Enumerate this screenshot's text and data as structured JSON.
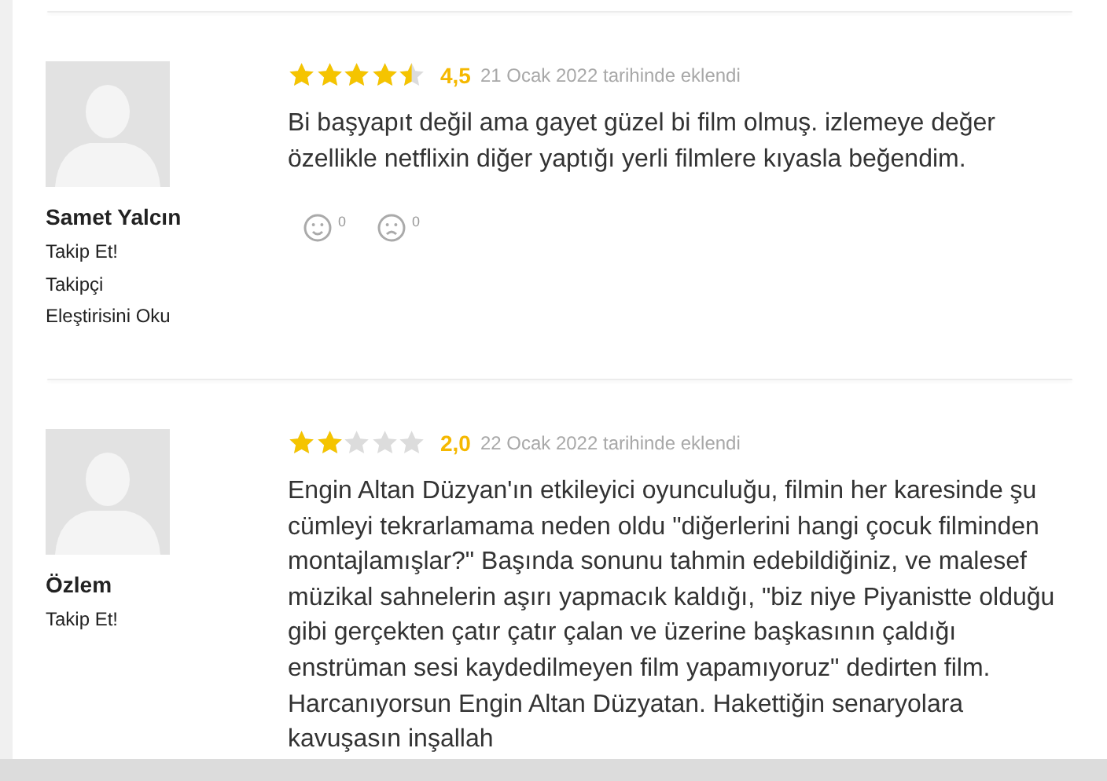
{
  "reviews": [
    {
      "author": "Samet Yalcın",
      "links": [
        "Takip Et!",
        "Takipçi",
        "Eleştirisini Oku"
      ],
      "stars": 4.5,
      "rating": "4,5",
      "date": "21 Ocak 2022 tarihinde eklendi",
      "text": "Bi başyapıt değil ama gayet güzel bi film olmuş. izlemeye değer özellikle netflixin diğer yaptığı yerli filmlere kıyasla beğendim.",
      "reactions": [
        {
          "kind": "like",
          "count": "0"
        },
        {
          "kind": "dislike",
          "count": "0"
        }
      ]
    },
    {
      "author": "Özlem",
      "links": [
        "Takip Et!"
      ],
      "stars": 2,
      "rating": "2,0",
      "date": "22 Ocak 2022 tarihinde eklendi",
      "text": "Engin Altan Düzyan'ın etkileyici oyunculuğu, filmin her karesinde şu cümleyi tekrarlamama neden oldu \"diğerlerini hangi çocuk filminden montajlamışlar?\" Başında sonunu tahmin edebildiğiniz, ve malesef müzikal sahnelerin aşırı yapmacık kaldığı, \"biz niye Piyanistte olduğu gibi gerçekten çatır çatır çalan ve üzerine başkasının çaldığı enstrüman sesi kaydedilmeyen film yapamıyoruz\" dedirten film. Harcanıyorsun Engin Altan Düzyatan. Hakettiğin senaryolara kavuşasın inşallah"
    }
  ]
}
